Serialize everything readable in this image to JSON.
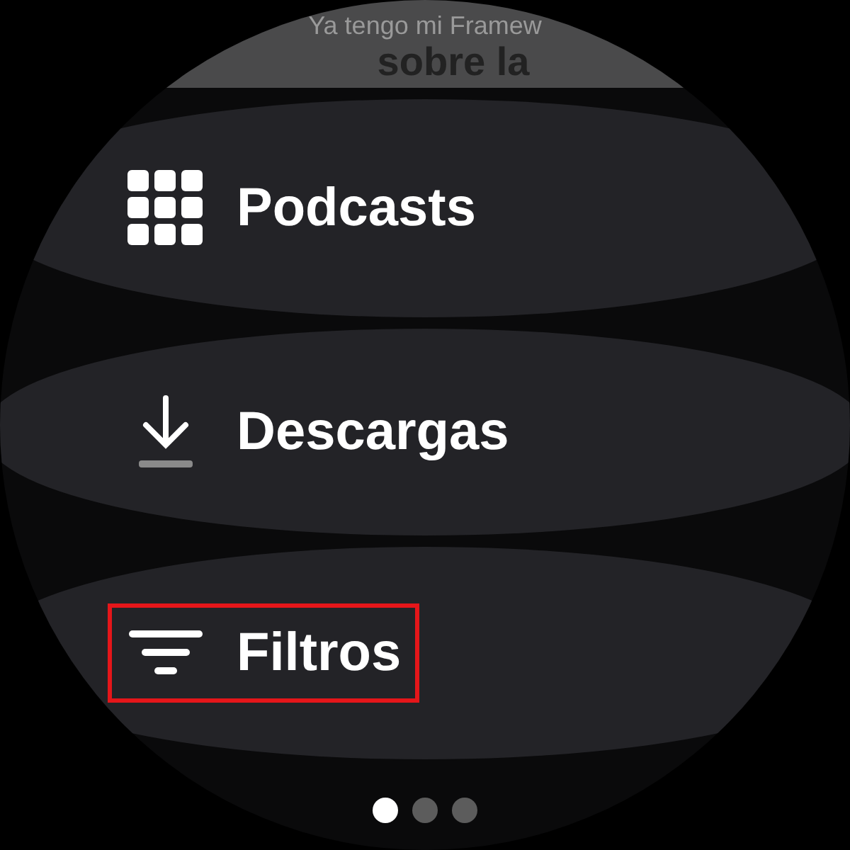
{
  "header": {
    "subtitle": "Ya tengo mi Framew",
    "title": "sobre la"
  },
  "menu": [
    {
      "kind": "grid",
      "label": "Podcasts",
      "highlighted": false
    },
    {
      "kind": "download",
      "label": "Descargas",
      "highlighted": false
    },
    {
      "kind": "filter",
      "label": "Filtros",
      "highlighted": true
    }
  ],
  "pages": [
    {
      "selected": true
    },
    {
      "selected": false
    },
    {
      "selected": false
    }
  ]
}
